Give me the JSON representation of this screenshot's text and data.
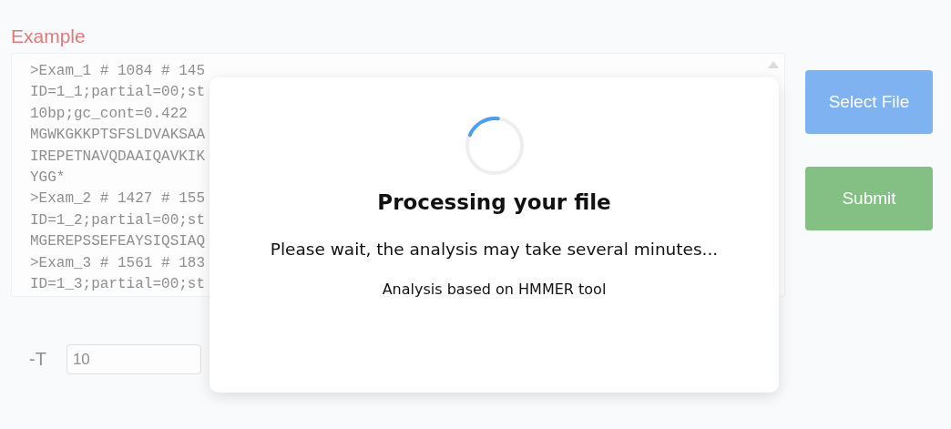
{
  "section_title": "Example",
  "sequence_box": {
    "lines": [
      ">Exam_1 # 1084 # 145",
      "ID=1_1;partial=00;st",
      "10bp;gc_cont=0.422",
      "MGWKGKKPTSFSLDVAKSAA",
      "IREPETNAVQDAAIQAVKIK",
      "YGG*",
      ">Exam_2 # 1427 # 155",
      "ID=1_2;partial=00;st",
      "MGEREPSSEFEAYSIQSIAQ",
      ">Exam_3 # 1561 # 183",
      "ID=1_3;partial=00;st"
    ]
  },
  "parameter": {
    "label": "-T",
    "value": "10"
  },
  "buttons": [
    {
      "kind": "select",
      "label": "Select File"
    },
    {
      "kind": "submit",
      "label": "Submit"
    }
  ],
  "dialog": {
    "title": "Processing your file",
    "message": "Please wait, the analysis may take several minutes...",
    "note": "Analysis based on HMMER tool"
  }
}
